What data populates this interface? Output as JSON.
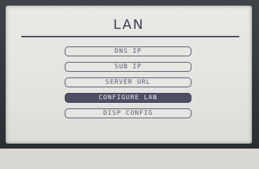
{
  "screen": {
    "title": "LAN",
    "menu_items": [
      {
        "label": "DNS IP",
        "selected": false
      },
      {
        "label": "SUB IP",
        "selected": false
      },
      {
        "label": "SERVER URL",
        "selected": false
      },
      {
        "label": "CONFIGURE LAN",
        "selected": true
      },
      {
        "label": "DISP CONFIG",
        "selected": false
      }
    ]
  },
  "colors": {
    "bezel": "#2f3336",
    "screen_bg": "#e6e6e2",
    "text": "#3e3e58",
    "selected_bg": "#4d4d66"
  }
}
